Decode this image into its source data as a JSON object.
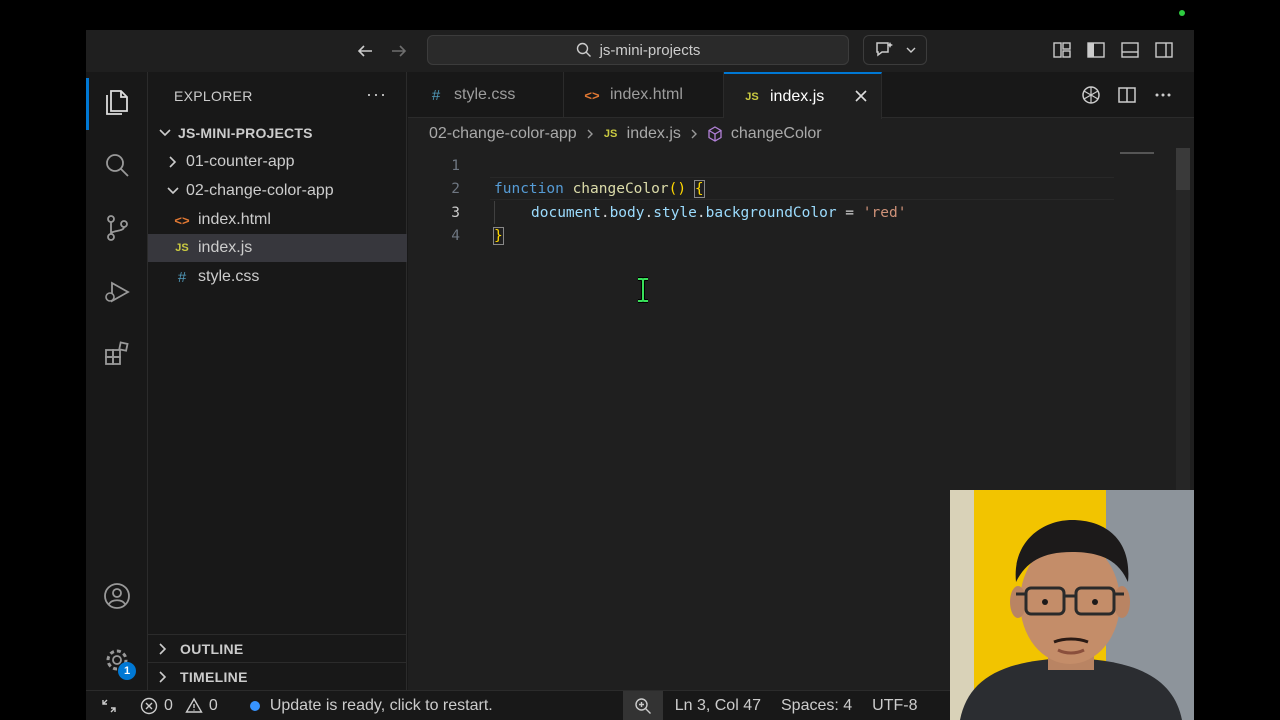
{
  "titlebar": {
    "search_text": "js-mini-projects"
  },
  "sidebar": {
    "title": "EXPLORER",
    "more": "···",
    "root_folder": "JS-MINI-PROJECTS",
    "tree": [
      {
        "label": "01-counter-app",
        "type": "folder",
        "expanded": false
      },
      {
        "label": "02-change-color-app",
        "type": "folder",
        "expanded": true
      },
      {
        "label": "index.html",
        "type": "file",
        "icon": "<>"
      },
      {
        "label": "index.js",
        "type": "file",
        "icon": "JS",
        "selected": true
      },
      {
        "label": "style.css",
        "type": "file",
        "icon": "#"
      }
    ],
    "outline": "OUTLINE",
    "timeline": "TIMELINE"
  },
  "activity": {
    "settings_badge": "1"
  },
  "tabs": [
    {
      "icon": "#",
      "label": "style.css"
    },
    {
      "icon": "<>",
      "label": "index.html"
    },
    {
      "icon": "JS",
      "label": "index.js",
      "active": true
    }
  ],
  "breadcrumb": {
    "folder": "02-change-color-app",
    "file_icon": "JS",
    "file": "index.js",
    "symbol": "changeColor"
  },
  "code": {
    "line_numbers": [
      "1",
      "2",
      "3",
      "4"
    ],
    "l2": {
      "kw": "function",
      "fn": "changeColor",
      "parens": "()",
      "brace": "{"
    },
    "l3": {
      "obj": "document",
      "dot1": ".",
      "p1": "body",
      "dot2": ".",
      "p2": "style",
      "dot3": ".",
      "p3": "backgroundColor",
      "op": " = ",
      "str": "'red'"
    },
    "l4": {
      "brace": "}"
    }
  },
  "statusbar": {
    "errors": "0",
    "warnings": "0",
    "update_msg": "Update is ready, click to restart.",
    "position": "Ln 3, Col 47",
    "spaces": "Spaces: 4",
    "encoding": "UTF-8"
  },
  "colors": {
    "accent": "#0078d4",
    "keyword": "#569cd6",
    "function": "#dcdcaa",
    "string": "#ce9178",
    "property": "#9cdcfe"
  }
}
